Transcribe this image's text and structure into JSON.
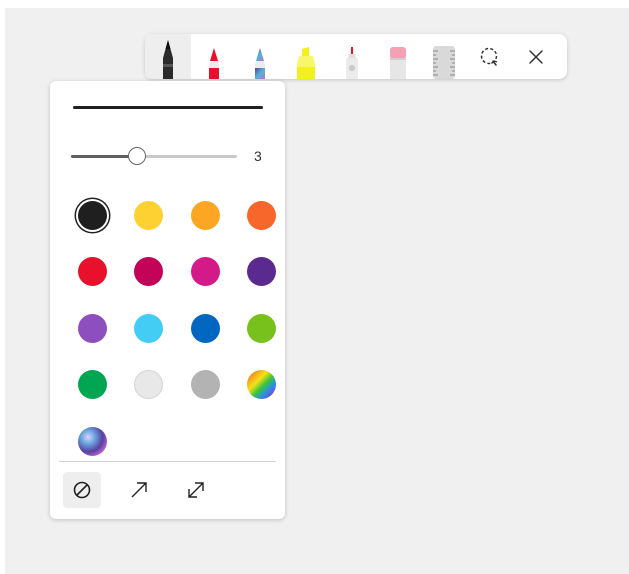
{
  "toolbar": {
    "tools": [
      {
        "name": "ballpoint-pen",
        "icon": "ballpoint-pen-icon",
        "selected": true
      },
      {
        "name": "red-pen",
        "icon": "red-pen-icon"
      },
      {
        "name": "galaxy-pen",
        "icon": "galaxy-pen-icon"
      },
      {
        "name": "highlighter",
        "icon": "highlighter-icon"
      },
      {
        "name": "pencil",
        "icon": "pencil-icon"
      },
      {
        "name": "eraser",
        "icon": "eraser-icon"
      },
      {
        "name": "ruler",
        "icon": "ruler-icon"
      },
      {
        "name": "lasso-select",
        "icon": "lasso-select-icon"
      },
      {
        "name": "close",
        "icon": "close-icon"
      }
    ]
  },
  "pen_settings": {
    "thickness_value": "3",
    "thickness_fraction": 0.4,
    "stroke_color": "#202020",
    "colors": [
      {
        "name": "black",
        "color": "#1f1f1f",
        "selected": true
      },
      {
        "name": "yellow",
        "color": "#fdd132"
      },
      {
        "name": "orange",
        "color": "#fca623"
      },
      {
        "name": "dark-orange",
        "color": "#f7672b"
      },
      {
        "name": "red",
        "color": "#e8102a"
      },
      {
        "name": "crimson",
        "color": "#c20357"
      },
      {
        "name": "magenta",
        "color": "#d31a88"
      },
      {
        "name": "purple",
        "color": "#5b2a91"
      },
      {
        "name": "lavender",
        "color": "#8d4fbe"
      },
      {
        "name": "light-blue",
        "color": "#43cdf5"
      },
      {
        "name": "blue",
        "color": "#0067c0"
      },
      {
        "name": "lime",
        "color": "#78c11c"
      },
      {
        "name": "green",
        "color": "#00a651"
      },
      {
        "name": "light-gray",
        "color": "#e8e8e8"
      },
      {
        "name": "gray",
        "color": "#b3b3b3"
      },
      {
        "name": "rainbow",
        "color": "rainbow"
      },
      {
        "name": "galaxy",
        "color": "galaxy"
      }
    ],
    "footer": [
      {
        "name": "no-arrow",
        "icon": "no-arrow-icon",
        "active": true
      },
      {
        "name": "end-arrow",
        "icon": "end-arrow-icon"
      },
      {
        "name": "double-arrow",
        "icon": "double-arrow-icon"
      }
    ]
  }
}
